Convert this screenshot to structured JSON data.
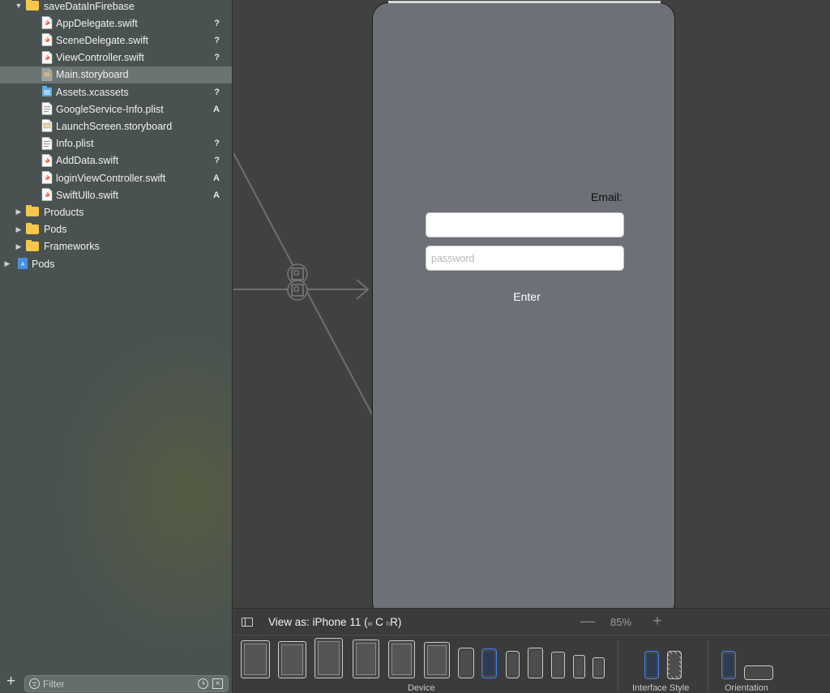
{
  "navigator": {
    "items": [
      {
        "label": "saveDataInFirebase",
        "kind": "folder",
        "depth": 1,
        "disclosure": "open",
        "badge": ""
      },
      {
        "label": "AppDelegate.swift",
        "kind": "swift",
        "depth": 2,
        "badge": "?"
      },
      {
        "label": "SceneDelegate.swift",
        "kind": "swift",
        "depth": 2,
        "badge": "?"
      },
      {
        "label": "ViewController.swift",
        "kind": "swift",
        "depth": 2,
        "badge": "?"
      },
      {
        "label": "Main.storyboard",
        "kind": "storyboard",
        "depth": 2,
        "badge": "",
        "selected": true
      },
      {
        "label": "Assets.xcassets",
        "kind": "assets",
        "depth": 2,
        "badge": "?"
      },
      {
        "label": "GoogleService-Info.plist",
        "kind": "plist",
        "depth": 2,
        "badge": "A"
      },
      {
        "label": "LaunchScreen.storyboard",
        "kind": "storyboard",
        "depth": 2,
        "badge": ""
      },
      {
        "label": "Info.plist",
        "kind": "plist",
        "depth": 2,
        "badge": "?"
      },
      {
        "label": "AddData.swift",
        "kind": "swift",
        "depth": 2,
        "badge": "?"
      },
      {
        "label": "loginViewController.swift",
        "kind": "swift",
        "depth": 2,
        "badge": "A"
      },
      {
        "label": "SwiftUllo.swift",
        "kind": "swift",
        "depth": 2,
        "badge": "A"
      },
      {
        "label": "Products",
        "kind": "folder",
        "depth": 1,
        "disclosure": "closed",
        "badge": ""
      },
      {
        "label": "Pods",
        "kind": "folder",
        "depth": 1,
        "disclosure": "closed",
        "badge": ""
      },
      {
        "label": "Frameworks",
        "kind": "folder",
        "depth": 1,
        "disclosure": "closed",
        "badge": ""
      },
      {
        "label": "Pods",
        "kind": "project",
        "depth": 0,
        "disclosure": "closed",
        "badge": ""
      }
    ],
    "filter": {
      "placeholder": "Filter"
    },
    "add_label": "+"
  },
  "storyboard": {
    "email_label": "Email:",
    "email_value": "",
    "password_placeholder": "password",
    "enter_label": "Enter"
  },
  "device_bar": {
    "view_as_prefix": "View as: iPhone 11 (",
    "w_label": "w",
    "c_label": " C ",
    "h_label": "h",
    "r_label": "R)",
    "zoom_minus": "—",
    "zoom_level": "85%",
    "zoom_plus": "+",
    "device_label": "Device",
    "interface_style_label": "Interface Style",
    "orientation_label": "Orientation"
  },
  "colors": {
    "accent": "#3b82f6",
    "folder": "#f5c74a",
    "swift": "#f05138",
    "canvas_view": "#6e7078"
  }
}
